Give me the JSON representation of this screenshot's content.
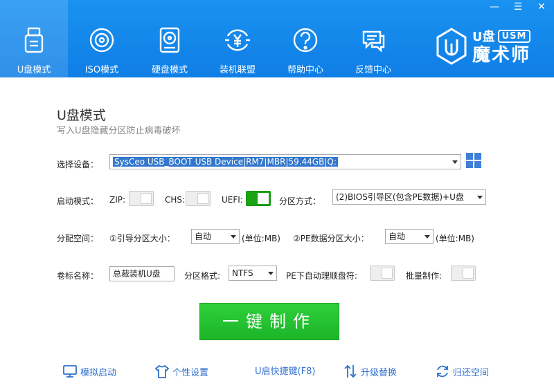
{
  "window": {
    "controls": [
      "minimize-icon",
      "menu-icon",
      "close-icon"
    ]
  },
  "nav": {
    "items": [
      {
        "label": "U盘模式",
        "icon": "usb-drive-icon"
      },
      {
        "label": "ISO模式",
        "icon": "disc-icon"
      },
      {
        "label": "硬盘模式",
        "icon": "hard-disk-icon"
      },
      {
        "label": "装机联盟",
        "icon": "yen-coin-icon"
      },
      {
        "label": "帮助中心",
        "icon": "help-icon"
      },
      {
        "label": "反馈中心",
        "icon": "feedback-chat-icon"
      }
    ],
    "active_index": 0
  },
  "brand": {
    "top": "U盘",
    "badge": "USM",
    "main": "魔术师"
  },
  "page": {
    "title": "U盘模式",
    "subtitle": "写入U盘隐藏分区防止病毒破坏"
  },
  "form": {
    "device_label": "选择设备：",
    "device_value": "SysCeo USB_BOOT USB Device|RM7|MBR|59.44GB|Q:",
    "boot_mode_label": "启动模式：",
    "zip_label": "ZIP:",
    "zip_on": false,
    "chs_label": "CHS:",
    "chs_on": false,
    "uefi_label": "UEFI:",
    "uefi_on": true,
    "partition_method_label": "分区方式：",
    "partition_method_value": "(2)BIOS引导区(包含PE数据)+U盘",
    "alloc_label": "分配空间：",
    "boot_size_label": "①引导分区大小：",
    "boot_size_value": "自动",
    "unit1": "(单位:MB)",
    "pe_size_label": "②PE数据分区大小：",
    "pe_size_value": "自动",
    "unit2": "(单位:MB)",
    "volume_label": "卷标名称：",
    "volume_value": "总裁装机U盘",
    "fs_label": "分区格式:",
    "fs_value": "NTFS",
    "pe_auto_label": "PE下自动理顺盘符:",
    "pe_auto_on": false,
    "batch_label": "批量制作:",
    "batch_on": false
  },
  "action": {
    "label": "一键制作"
  },
  "colors": {
    "header": "#1486ea",
    "accent_green": "#1cb528",
    "link": "#2f6fd0"
  },
  "footer": {
    "items": [
      {
        "label": "模拟启动",
        "icon": "monitor-icon"
      },
      {
        "label": "个性设置",
        "icon": "tshirt-icon"
      },
      {
        "label": "U启快捷键(F8)",
        "icon": ""
      },
      {
        "label": "升级替换",
        "icon": "upgrade-arrows-icon"
      },
      {
        "label": "归还空间",
        "icon": "restore-icon"
      }
    ]
  }
}
